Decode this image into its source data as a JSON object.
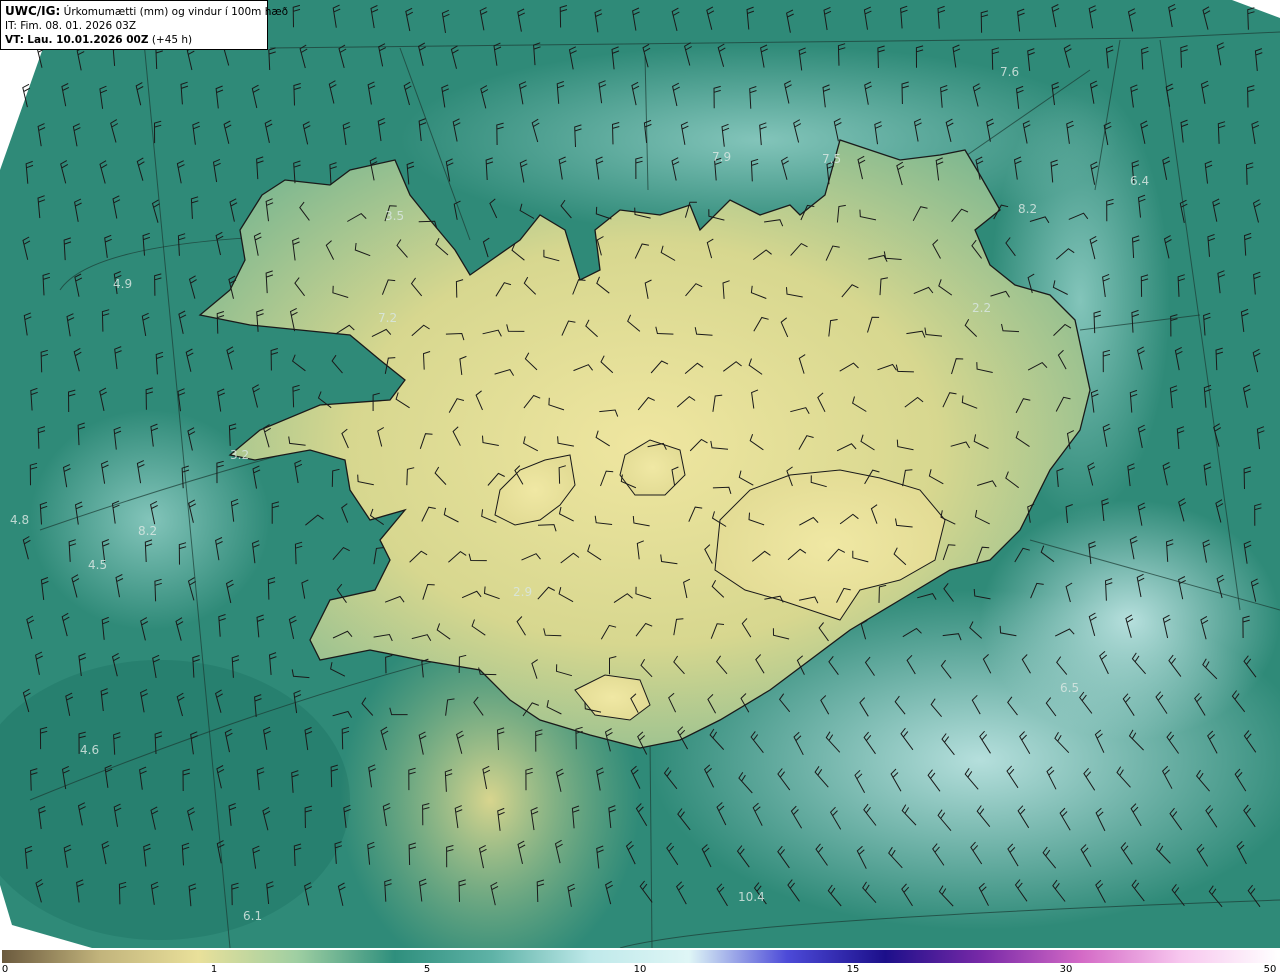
{
  "header": {
    "model": "UWC/IG:",
    "title": "Úrkomumætti (mm) og vindur í 100m hæð",
    "issue_time": "IT: Fim. 08. 01. 2026 03Z",
    "valid_prefix": "VT:",
    "valid_time": "Lau. 10.01.2026 00Z",
    "lead": "(+45 h)"
  },
  "colorbar": {
    "ticks": [
      "0",
      "1",
      "5",
      "10",
      "15",
      "30",
      "50"
    ],
    "colors": [
      "#6b5a3e",
      "#c2b47c",
      "#e9e09a",
      "#9fcfa2",
      "#2f8f7d",
      "#5fb3a7",
      "#bfe9ea",
      "#dff6f6",
      "#4c4ad8",
      "#1c0f8a",
      "#7a2aa8",
      "#d46ac6",
      "#f7c6ee",
      "#ffffff"
    ]
  },
  "map_values": [
    "7.6",
    "7.9",
    "7.5",
    "6.4",
    "3.5",
    "8.2",
    "4.9",
    "7.2",
    "2.2",
    "3.2",
    "4.8",
    "8.2",
    "4.5",
    "2.9",
    "6.5",
    "4.6",
    "6.1",
    "10.4"
  ],
  "colors": {
    "ocean": "#2f8a78",
    "ocean_light": "#6fbdb3",
    "land_low": "#8cbf8e",
    "land_high": "#e7df98",
    "coast": "#1a1a1a",
    "barb": "#1a1a1a"
  }
}
